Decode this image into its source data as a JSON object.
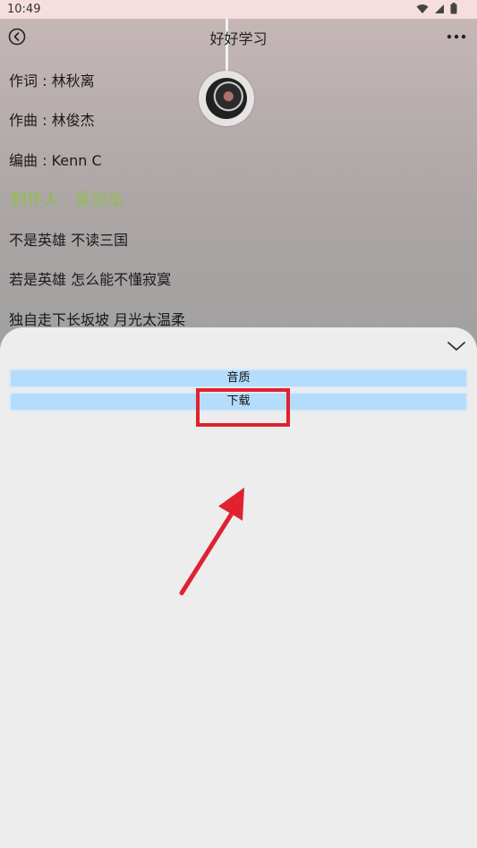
{
  "status_bar": {
    "time": "10:49",
    "icons": [
      "wifi-icon",
      "signal-icon",
      "battery-icon"
    ]
  },
  "header": {
    "title": "好好学习",
    "back_icon": "back-circle-icon",
    "more_icon": "more-dots-icon"
  },
  "lyrics": [
    {
      "text": "作词 : 林秋离",
      "active": false
    },
    {
      "text": "作曲 : 林俊杰",
      "active": false
    },
    {
      "text": "编曲 : Kenn C",
      "active": false
    },
    {
      "text": "制作人 : 吴剑泓",
      "active": true
    },
    {
      "text": "不是英雄 不读三国",
      "active": false
    },
    {
      "text": "若是英雄 怎么能不懂寂寞",
      "active": false
    },
    {
      "text": "独自走下长坂坡 月光太温柔",
      "active": false
    }
  ],
  "sheet": {
    "collapse_icon": "chevron-down-icon",
    "options": [
      {
        "label": "音质"
      },
      {
        "label": "下载"
      }
    ]
  },
  "colors": {
    "active_lyric": "#8bbf4a",
    "option_bg": "#b5dcfb",
    "annotation": "#e02230",
    "status_bar_bg": "#f7dede"
  }
}
